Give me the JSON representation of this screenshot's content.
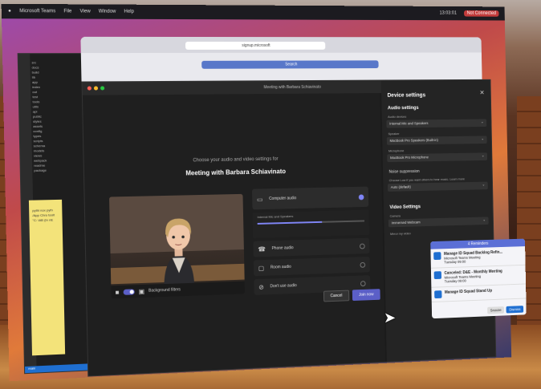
{
  "menubar": {
    "app": "Microsoft Teams",
    "items": [
      "File",
      "View",
      "Window",
      "Help"
    ],
    "recording": "Not Connected",
    "clock": "13:03:01"
  },
  "vscode": {
    "files": [
      "src",
      "docs",
      "build",
      "lib",
      "app",
      "index",
      "out",
      "test",
      "tools",
      "utils",
      "api",
      "public",
      "styles",
      "assets",
      "config",
      "types",
      "scripts",
      "schema",
      "models",
      "views",
      "webpack",
      "readme",
      "package"
    ],
    "status": "main"
  },
  "notes_code": "pythi nox pyth /App Chro toolt \"C: \\AB (In nE",
  "safari": {
    "address": "signup.microsoft",
    "search": "Search"
  },
  "teams": {
    "window_title": "Meeting with Barbara Schiavinato",
    "choose_text": "Choose your audio and video settings for",
    "meeting_title": "Meeting with Barbara Schiavinato",
    "background_filters": "Background filters",
    "audio_options": [
      {
        "label": "Computer audio",
        "icon": "monitor-icon",
        "selected": true
      },
      {
        "label": "Phone audio",
        "icon": "phone-icon",
        "selected": false
      },
      {
        "label": "Room audio",
        "icon": "room-icon",
        "selected": false
      },
      {
        "label": "Don't use audio",
        "icon": "no-audio-icon",
        "selected": false
      }
    ],
    "speakers_label": "Internal Mic and Speakers",
    "cancel": "Cancel",
    "join": "Join now"
  },
  "settings": {
    "title": "Device settings",
    "audio_heading": "Audio settings",
    "audio_device_label": "Audio devices",
    "audio_device": "Internal Mic and Speakers",
    "speaker_label": "Speaker",
    "speaker": "MacBook Pro Speakers (Built-in)",
    "mic_label": "Microphone",
    "mic": "MacBook Pro Microphone",
    "noise_label": "Noise suppression",
    "noise_desc": "Choose Low if you want others to hear music. Learn more",
    "noise_value": "Auto (default)",
    "video_heading": "Video Settings",
    "camera_label": "Camera",
    "camera": "Immersed Webcam",
    "mirror": "Mirror my video"
  },
  "notification": {
    "header": "4 Reminders",
    "items": [
      {
        "title": "Manage ID Squad Backlog Refin...",
        "sub": "Microsoft Teams Meeting",
        "time": "Tuesday 09:00"
      },
      {
        "title": "Canceled: D&E - Monthly Meeting",
        "sub": "Microsoft Teams Meeting",
        "time": "Tuesday 09:00"
      },
      {
        "title": "Manage ID Squad Stand Up",
        "sub": "",
        "time": ""
      }
    ],
    "snooze": "Snooze",
    "dismiss": "Dismiss"
  },
  "colors": {
    "accent": "#5b5fc7",
    "vscode_status": "#1f6fd1"
  }
}
